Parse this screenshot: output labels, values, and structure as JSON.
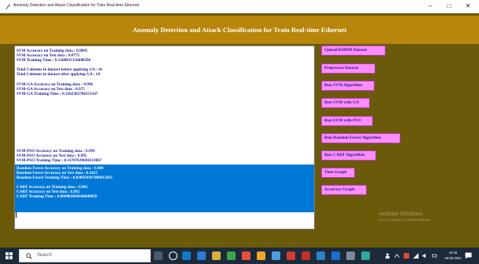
{
  "window": {
    "title": "Anomaly Detection and Attack Classification for Train Real-time Ethernet",
    "minimize": "–",
    "maximize": "□",
    "close": "✕"
  },
  "header": {
    "title": "Anomaly Detection and Attack Classification for Train Real-time Ethernet"
  },
  "output": {
    "lines": [
      "SVM Accuracy on Training data : 0.8895",
      "SVM Accuracy on Test data : 0.8775",
      "SVM Training Time : 0.1260831356048584",
      "Total Columns in dataset before applying GA : 41",
      "Total Columns in dataset after applying GA : 24",
      "SVM-GA Accuracy on Training data : 0.996",
      "SVM-GA Accuracy on Test data : 0.975",
      "SVM-GA Training Time : 0.3362302780151367",
      "SVM-PSO Accuracy on Training data : 0.999",
      "SVM-PSO Accuracy on Test data : 0.995",
      "SVM-PSO Training Time : 0.11707639694213867",
      "Random Forest Accuracy on Training data : 0.988",
      "Random Forest Accuracy on Test data : 0.2425",
      "Random Forest Training Time : 0.038024187088012695",
      "CART Accuracy on Training data : 0.985",
      "CART Accuracy on Test data : 0.965",
      "CART Training Time : 0.006002664566040039"
    ]
  },
  "buttons": {
    "upload": "Upload KDD99 Dataset",
    "preprocess": "Preprocess Dataset",
    "run_svm": "Run SVM Algorithm",
    "run_svm_ga": "Run SVM with GA",
    "run_svm_pso": "Run SVM with PSO",
    "run_rf": "Run Random Forest Algorithm",
    "run_cart": "Run CART Algorithm",
    "time_graph": "Time Graph",
    "accuracy_graph": "Accuracy Graph"
  },
  "watermark": {
    "line1": "Activate Windows",
    "line2": "Go to Settings to activate Windows."
  },
  "taskbar": {
    "search_placeholder": "Search",
    "time": "20:26",
    "date": "26-05-2021"
  },
  "colors": {
    "header_bg": "#b8860b",
    "app_bg": "#6b5a0a",
    "button_bg": "#ff8cff",
    "text_color": "#1a1a8c",
    "selection": "#0078d7",
    "taskbar": "#1c2a3a"
  }
}
